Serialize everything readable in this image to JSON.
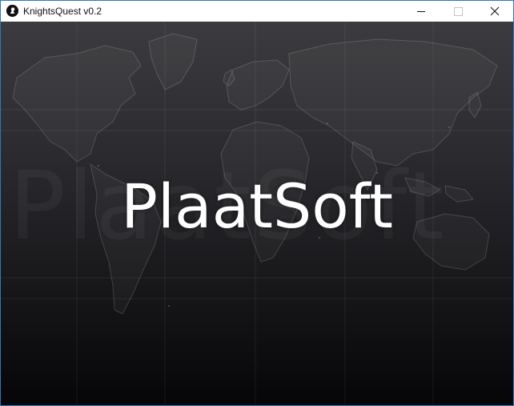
{
  "window": {
    "title": "KnightsQuest v0.2",
    "icon": "knight-icon",
    "controls": {
      "minimize": "minimize-icon",
      "maximize": "maximize-icon",
      "close": "close-icon"
    }
  },
  "splash": {
    "brand_text": "PlaatSoft",
    "watermark_text": "PlaatSoft"
  },
  "colors": {
    "window_border": "#2b79c2",
    "background_top": "#3c3b3f",
    "background_bottom": "#060507",
    "brand_text": "#ffffff"
  }
}
